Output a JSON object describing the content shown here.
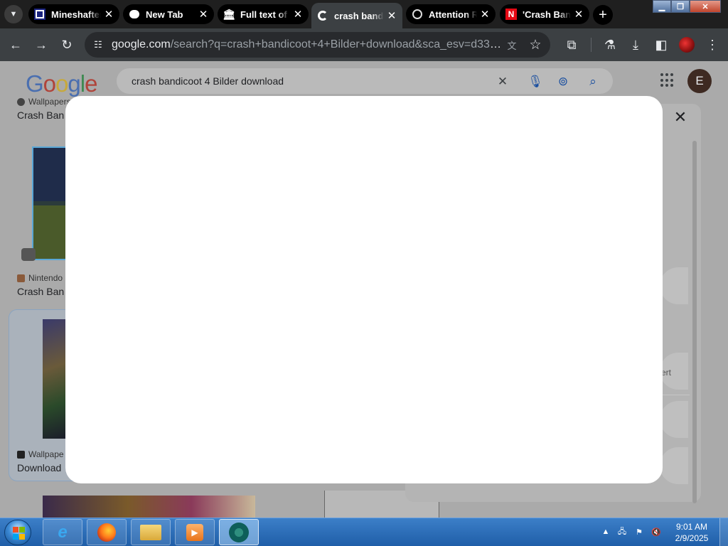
{
  "browser": {
    "tabs": [
      {
        "title": "Mineshafter",
        "favicon": "mineshafter-favicon",
        "active": false
      },
      {
        "title": "New Tab",
        "favicon": "chat-bubble-icon",
        "active": false
      },
      {
        "title": "Full text of",
        "favicon": "archive-icon",
        "active": false
      },
      {
        "title": "crash band",
        "favicon": "google-g-icon",
        "active": true
      },
      {
        "title": "Attention R",
        "favicon": "globe-icon",
        "active": false
      },
      {
        "title": "'Crash Ban",
        "favicon": "netflix-n-icon",
        "active": false
      }
    ],
    "address": {
      "domain": "google.com",
      "path": "/search?q=crash+bandicoot+4+Bilder+download&sca_esv=d338ee00b303..."
    }
  },
  "google": {
    "logo": "Google",
    "query": "crash bandicoot 4 Bilder download",
    "account_initial": "E"
  },
  "results": [
    {
      "source": "Wallpapers",
      "title": "Crash Ban"
    },
    {
      "source": "Nintendo",
      "title": "Crash Ban"
    },
    {
      "source": "Wallpape",
      "title": "Download"
    }
  ],
  "side_panel": {
    "partial_text": "ert"
  },
  "taskbar": {
    "time": "9:01 AM",
    "date": "2/9/2025"
  },
  "colors": {
    "google_blue": "#4285f4",
    "google_red": "#ea4335",
    "google_yellow": "#fbbc05",
    "google_green": "#34a853",
    "tab_active": "#3c4043",
    "toolbar": "#3c4043",
    "scrim": "#aaaaaa",
    "modal": "#ffffff"
  }
}
